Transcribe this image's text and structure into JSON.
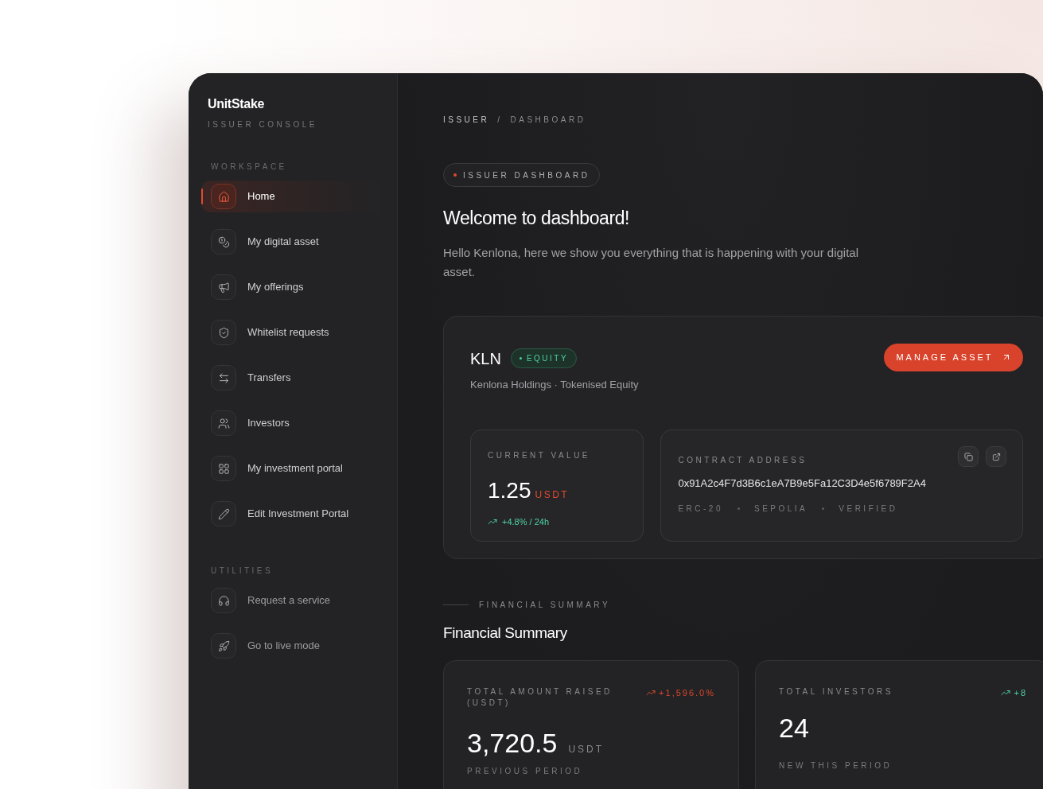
{
  "brand": {
    "name": "UnitStake",
    "subtitle": "ISSUER CONSOLE"
  },
  "sidebar": {
    "sections": [
      {
        "title": "WORKSPACE",
        "items": [
          {
            "label": "Home",
            "selected": true
          },
          {
            "label": "My digital asset",
            "selected": false
          },
          {
            "label": "My offerings",
            "selected": false
          },
          {
            "label": "Whitelist requests",
            "selected": false
          },
          {
            "label": "Transfers",
            "selected": false
          },
          {
            "label": "Investors",
            "selected": false
          },
          {
            "label": "My investment portal",
            "selected": false
          },
          {
            "label": "Edit Investment Portal",
            "selected": false
          }
        ]
      },
      {
        "title": "UTILITIES",
        "items": [
          {
            "label": "Request a service",
            "selected": false
          },
          {
            "label": "Go to live mode",
            "selected": false
          }
        ]
      }
    ]
  },
  "breadcrumb": [
    "ISSUER",
    "/",
    "DASHBOARD"
  ],
  "badge": "ISSUER DASHBOARD",
  "heading": "Welcome to dashboard!",
  "intro": "Hello Kenlona, here we show you everything that is happening with your digital asset.",
  "asset": {
    "ticker": "KLN",
    "tag": "EQUITY",
    "description": "Kenlona Holdings · Tokenised Equity",
    "button": "MANAGE ASSET",
    "value": {
      "label": "CURRENT VALUE",
      "amount": "1.25",
      "unit": "USDT",
      "change": "+4.8% / 24h"
    },
    "contract": {
      "label": "CONTRACT ADDRESS",
      "address": "0x91A2c4F7d3B6c1eA7B9e5Fa12C3D4e5f6789F2A4",
      "meta": [
        "ERC-20",
        "SEPOLIA",
        "VERIFIED"
      ]
    }
  },
  "summary": {
    "eyebrow": "FINANCIAL SUMMARY",
    "title": "Financial Summary",
    "cards": [
      {
        "label": "TOTAL AMOUNT RAISED (USDT)",
        "change": "+1,596.0%",
        "color": "#d9472b",
        "value": "3,720.5",
        "unit": "USDT",
        "footer": "PREVIOUS PERIOD"
      },
      {
        "label": "TOTAL INVESTORS",
        "change": "+8",
        "color": "#4fd1a1",
        "value": "24",
        "footer": "NEW THIS PERIOD"
      }
    ]
  }
}
